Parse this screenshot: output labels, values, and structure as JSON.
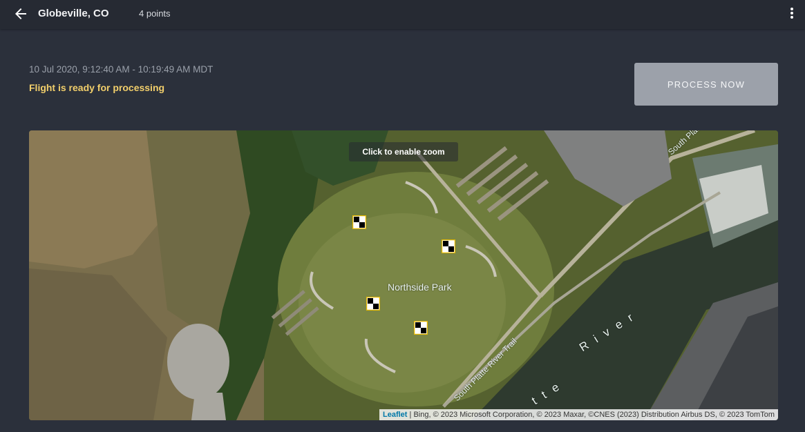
{
  "header": {
    "back_icon": "arrow-left-icon",
    "title": "Globeville, CO",
    "points": "4 points",
    "menu_icon": "more-vertical-icon"
  },
  "flight": {
    "date_range": "10 Jul 2020, 9:12:40 AM - 10:19:49 AM MDT",
    "status": "Flight is ready for processing",
    "status_color": "#f2cf6b"
  },
  "actions": {
    "process_label": "PROCESS NOW"
  },
  "map": {
    "zoom_hint": "Click to enable zoom",
    "labels": {
      "park": "Northside Park",
      "trail_top": "South Platte River",
      "trail_bottom": "South Platte River Trail",
      "river_word1": "River",
      "river_word2": "tte"
    },
    "gcp_icon": "ground-control-point-icon",
    "attribution": {
      "leaflet": "Leaflet",
      "sources": " | Bing, © 2023 Microsoft Corporation, © 2023 Maxar, ©CNES (2023) Distribution Airbus DS, © 2023 TomTom"
    }
  },
  "colors": {
    "background": "#2b303b",
    "topbar": "#262a33",
    "button": "#9ca1aa"
  }
}
